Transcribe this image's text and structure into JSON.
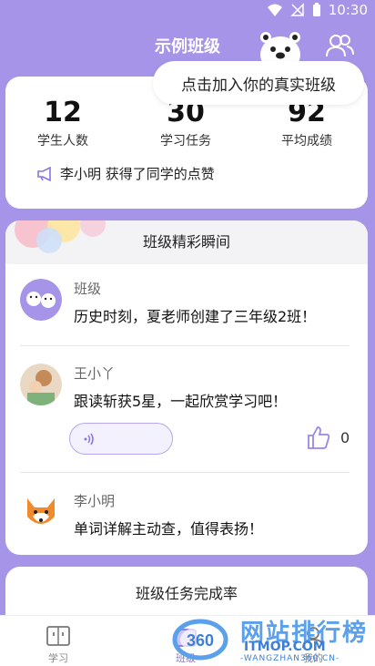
{
  "status_bar": {
    "time": "10:30"
  },
  "header": {
    "title": "示例班级"
  },
  "tooltip": {
    "text": "点击加入你的真实班级"
  },
  "stats": [
    {
      "value": "12",
      "label": "学生人数"
    },
    {
      "value": "30",
      "label": "学习任务"
    },
    {
      "value": "92",
      "label": "平均成绩"
    }
  ],
  "like_notice": "李小明 获得了同学的点赞",
  "moments": {
    "title": "班级精彩瞬间",
    "items": [
      {
        "name": "班级",
        "message": "历史时刻，夏老师创建了三年级2班！"
      },
      {
        "name": "王小丫",
        "message": "跟读斩获5星，一起欣赏学习吧！",
        "likes": "0"
      },
      {
        "name": "李小明",
        "message": "单词详解主动查，值得表扬！"
      }
    ]
  },
  "task_card": {
    "title": "班级任务完成率"
  },
  "tabs": [
    {
      "label": "学习"
    },
    {
      "label": "班级"
    },
    {
      "label": "我的"
    }
  ],
  "watermark": {
    "line1": "网站排行榜",
    "line2": "ITMOP.COM",
    "line3": "-WANGZHAN360.CN-",
    "logo": "360"
  },
  "colors": {
    "accent": "#a594e8",
    "active_tab": "#8a74e0"
  }
}
